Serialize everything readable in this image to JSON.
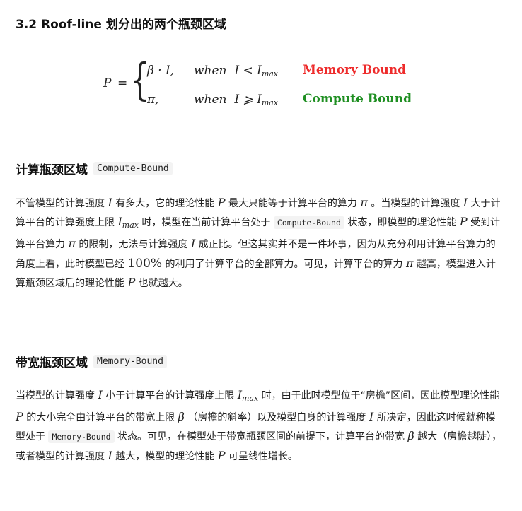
{
  "heading_main": "3.2 Roof-line 划分出的两个瓶颈区域",
  "formula": {
    "lhs": "P",
    "eq": "=",
    "row1": {
      "expr": "β · I,",
      "cond_when": "when",
      "cond": "I < I",
      "cond_sub": "max",
      "label": "Memory Bound",
      "label_color": "#ee2b2b"
    },
    "row2": {
      "expr": "π,",
      "cond_when": "when",
      "cond": "I ⩾ I",
      "cond_sub": "max",
      "label": "Compute Bound",
      "label_color": "#1f8f22"
    }
  },
  "section_compute": {
    "title": "计算瓶颈区域",
    "code": "Compute-Bound",
    "p": {
      "t1": "不管模型的计算强度 ",
      "m1": "I",
      "t2": " 有多大，它的理论性能 ",
      "m2": "P",
      "t3": " 最大只能等于计算平台的算力 ",
      "m3": "π",
      "t4": " 。当模型的计算强度 ",
      "m4": "I",
      "t5": " 大于计算平台的计算强度上限 ",
      "m5": "I",
      "m5_sub": "max",
      "t6": " 时，模型在当前计算平台处于 ",
      "code1": "Compute-Bound",
      "t7": " 状态，即模型的理论性能 ",
      "m6": "P",
      "t8": " 受到计算平台算力 ",
      "m7": "π",
      "t9": " 的限制，无法与计算强度 ",
      "m8": "I",
      "t10": " 成正比。但这其实并不是一件坏事，因为从充分利用计算平台算力的角度上看，此时模型已经 ",
      "n1": "100%",
      "t11": " 的利用了计算平台的全部算力。可见，计算平台的算力 ",
      "m9": "π",
      "t12": " 越高，模型进入计算瓶颈区域后的理论性能 ",
      "m10": "P",
      "t13": " 也就越大。"
    }
  },
  "section_memory": {
    "title": "带宽瓶颈区域",
    "code": "Memory-Bound",
    "p": {
      "t1": "当模型的计算强度 ",
      "m1": "I",
      "t2": " 小于计算平台的计算强度上限 ",
      "m2": "I",
      "m2_sub": "max",
      "t3": " 时，由于此时模型位于“房檐”区间，因此模型理论性能 ",
      "m3": "P",
      "t4": " 的大小完全由计算平台的带宽上限 ",
      "m4": "β",
      "t5": " （房檐的斜率）以及模型自身的计算强度 ",
      "m5": "I",
      "t6": " 所决定，因此这时候就称模型处于 ",
      "code1": "Memory-Bound",
      "t7": " 状态。可见，在模型处于带宽瓶颈区间的前提下，计算平台的带宽 ",
      "m6": "β",
      "t8": " 越大（房檐越陡），或者模型的计算强度 ",
      "m7": "I",
      "t9": " 越大，模型的理论性能 ",
      "m8": "P",
      "t10": " 可呈线性增长。"
    }
  }
}
